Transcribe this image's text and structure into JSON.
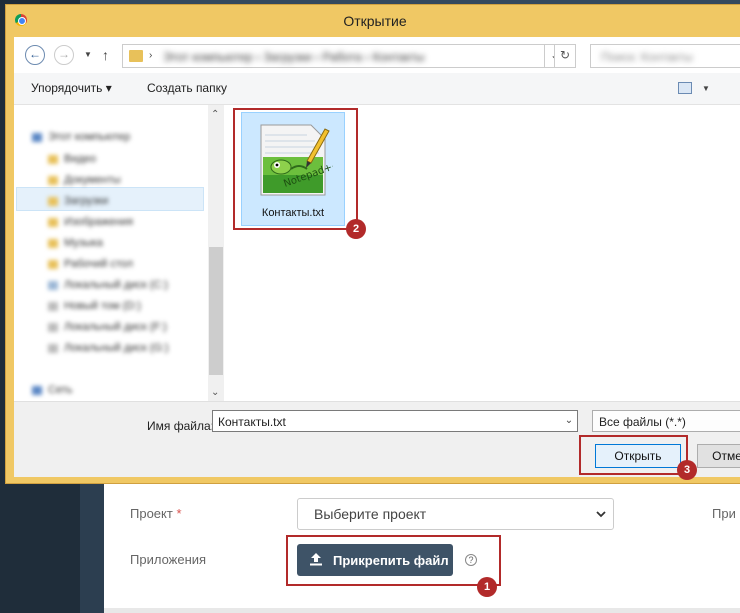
{
  "background_page": {
    "project_label": "Проект",
    "required_mark": "*",
    "project_placeholder": "Выберите проект",
    "right_label": "При",
    "attachments_label": "Приложения",
    "attach_button": "Прикрепить файл",
    "help_glyph": "?"
  },
  "dialog": {
    "title": "Открытие",
    "address_crumbs": "Этот компьютер › Загрузки › Работа › Контакты",
    "search_placeholder": "Поиск: Контакты",
    "toolbar": {
      "organize": "Упорядочить ▾",
      "new_folder": "Создать папку"
    },
    "tree": [
      "Этот компьютер",
      "Видео",
      "Документы",
      "Загрузки",
      "Изображения",
      "Музыка",
      "Рабочий стол",
      "Локальный диск (C:)",
      "Новый том (D:)",
      "Локальный диск (F:)",
      "Локальный диск (G:)",
      "Сеть"
    ],
    "file": {
      "name": "Контакты.txt",
      "icon": "notepad-plus-plus-icon"
    },
    "filename_label": "Имя файла:",
    "filename_value": "Контакты.txt",
    "filetype_value": "Все файлы (*.*)",
    "open_button": "Открыть",
    "cancel_button": "Отме"
  },
  "annotations": {
    "badge_1": "1",
    "badge_2": "2",
    "badge_3": "3",
    "color": "#b22a2a"
  }
}
